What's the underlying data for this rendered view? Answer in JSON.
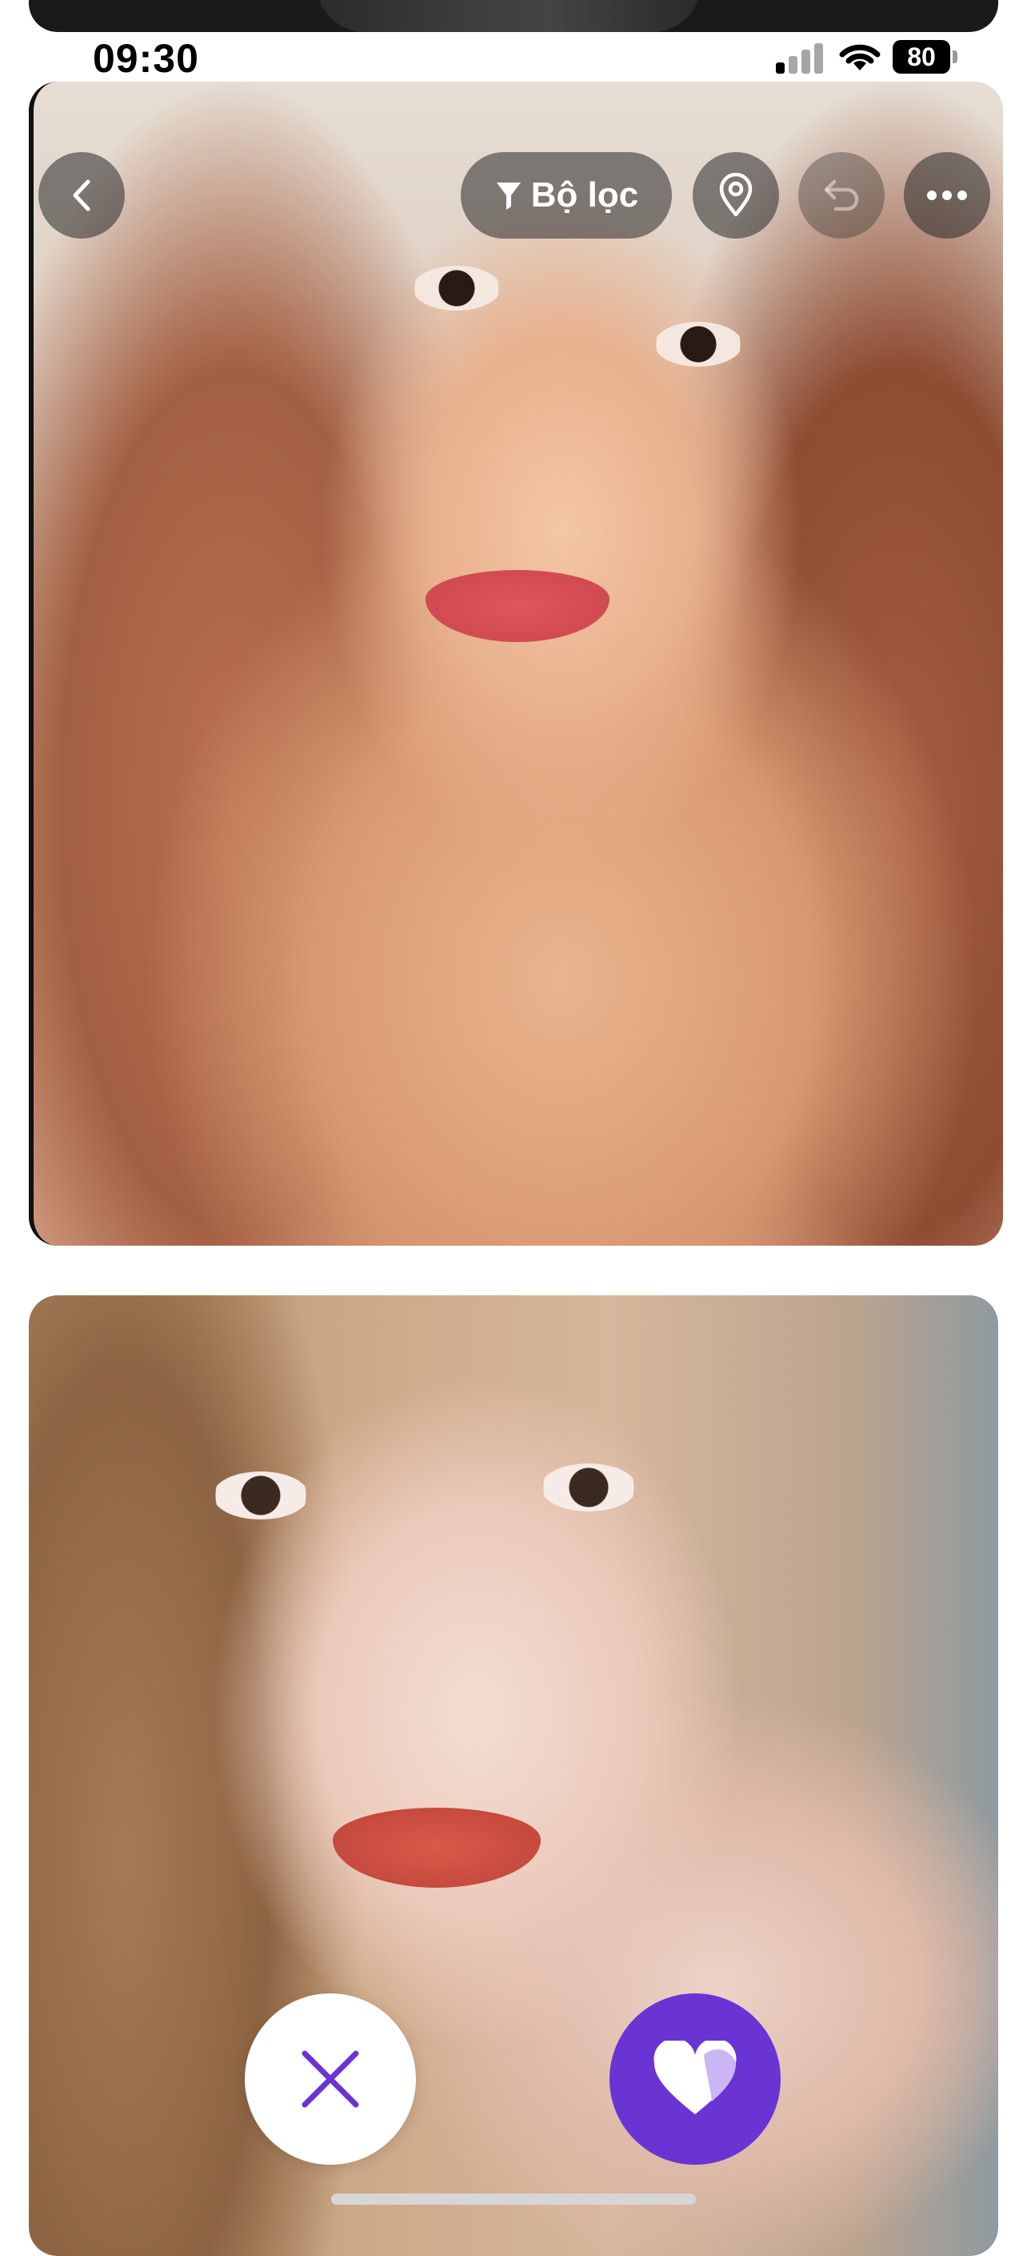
{
  "status_bar": {
    "time": "09:30",
    "battery_level": "80",
    "icons": [
      "signal-icon",
      "wifi-icon",
      "battery-icon"
    ]
  },
  "top_controls": {
    "back_icon": "chevron-left-icon",
    "filter_label": "Bộ lọc",
    "filter_icon": "filter-icon",
    "location_icon": "location-pin-icon",
    "undo_icon": "undo-icon",
    "more_icon": "more-horizontal-icon"
  },
  "actions": {
    "dislike_icon": "close-icon",
    "like_icon": "heart-icon"
  },
  "colors": {
    "accent": "#6a34d4",
    "dislike_glyph": "#6a34d4",
    "overlay_button": "rgba(40,40,40,0.55)"
  }
}
